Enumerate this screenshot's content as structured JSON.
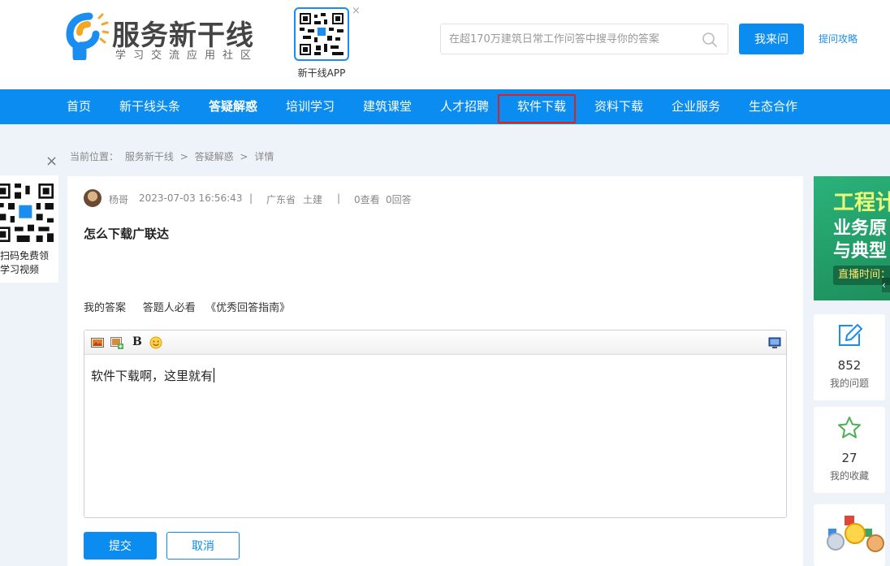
{
  "header": {
    "logo_title": "服务新干线",
    "logo_subtitle": "学习交流应用社区",
    "app_qr_label": "新干线APP",
    "app_qr_close": "×",
    "search_placeholder": "在超170万建筑日常工作问答中搜寻你的答案",
    "ask_button": "我来问",
    "guide_link": "提问攻略"
  },
  "nav": {
    "items": [
      "首页",
      "新干线头条",
      "答疑解惑",
      "培训学习",
      "建筑课堂",
      "人才招聘",
      "软件下载",
      "资料下载",
      "企业服务",
      "生态合作"
    ],
    "active_index": 2,
    "highlight_index": 6
  },
  "breadcrumb": {
    "prefix": "当前位置：",
    "items": [
      "服务新干线",
      ">",
      "答疑解惑",
      ">",
      "详情"
    ]
  },
  "float_qr": {
    "close": "×",
    "line1": "扫码免费领",
    "line2": "学习视频"
  },
  "question": {
    "author": "杨哥",
    "datetime": "2023-07-03 16:56:43",
    "sep": "|",
    "region": "广东省",
    "category": "土建",
    "views": "0查看",
    "answers": "0回答",
    "title": "怎么下载广联达"
  },
  "answer": {
    "label": "我的答案",
    "must_read": "答题人必看",
    "guide": "《优秀回答指南》",
    "content": "软件下载啊，这里就有",
    "submit": "提交",
    "cancel": "取消"
  },
  "sidebar": {
    "banner": {
      "line1": "工程计",
      "line2": "业务原",
      "line3": "与典型",
      "live": "直播时间：",
      "arrow": "‹"
    },
    "my_questions": {
      "count": "852",
      "label": "我的问题"
    },
    "my_favorites": {
      "count": "27",
      "label": "我的收藏"
    }
  },
  "colors": {
    "brand_blue": "#0a8cf0",
    "highlight_red": "#e02020",
    "logo_yellow": "#f5a623"
  }
}
